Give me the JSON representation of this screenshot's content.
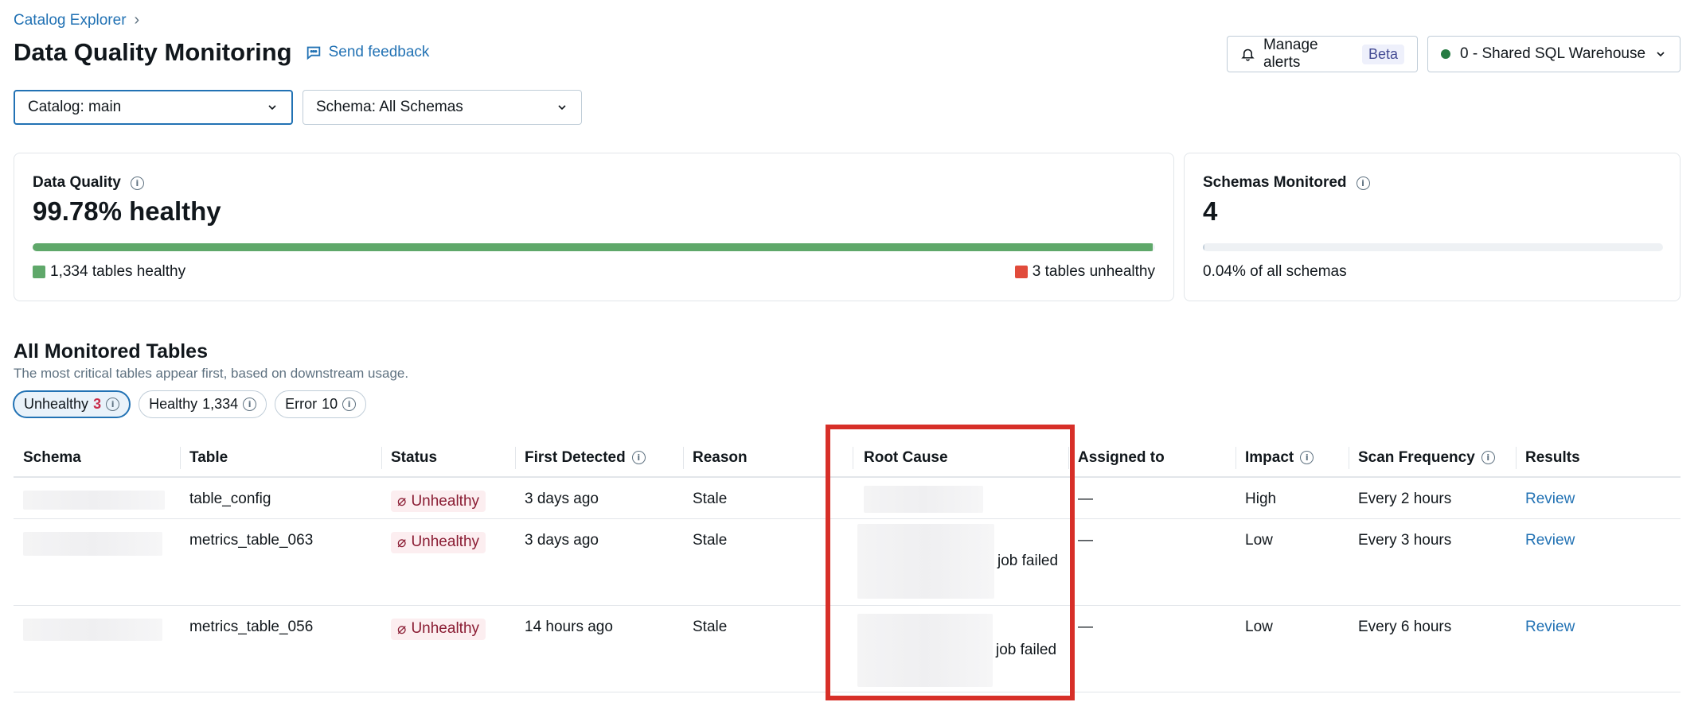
{
  "breadcrumb": {
    "root": "Catalog Explorer",
    "chevron": "›"
  },
  "header": {
    "title": "Data Quality Monitoring",
    "feedback": "Send feedback",
    "manage_alerts": "Manage alerts",
    "beta": "Beta",
    "warehouse": "0 - Shared SQL Warehouse"
  },
  "filters": {
    "catalog": "Catalog: main",
    "schema": "Schema: All Schemas"
  },
  "quality_card": {
    "label": "Data Quality",
    "value": "99.78% healthy",
    "healthy_fraction": 0.9978,
    "healthy_label": "1,334 tables healthy",
    "unhealthy_label": "3 tables unhealthy",
    "healthy_color": "#5fa86a",
    "unhealthy_color": "#e14b3b"
  },
  "schemas_card": {
    "label": "Schemas Monitored",
    "value": "4",
    "fraction": 0.0004,
    "caption": "0.04% of all schemas"
  },
  "section": {
    "title": "All Monitored Tables",
    "subtitle": "The most critical tables appear first, based on downstream usage."
  },
  "pills": [
    {
      "label": "Unhealthy",
      "count": "3"
    },
    {
      "label": "Healthy",
      "count": "1,334"
    },
    {
      "label": "Error",
      "count": "10"
    }
  ],
  "table": {
    "columns": [
      "Schema",
      "Table",
      "Status",
      "First Detected",
      "Reason",
      "Root Cause",
      "Assigned to",
      "Impact",
      "Scan Frequency",
      "Results"
    ],
    "rows": [
      {
        "table": "table_config",
        "status": "Unhealthy",
        "first_detected": "3 days ago",
        "reason": "Stale",
        "root_cause": "",
        "assigned": "—",
        "impact": "High",
        "frequency": "Every 2 hours",
        "results": "Review"
      },
      {
        "table": "metrics_table_063",
        "status": "Unhealthy",
        "first_detected": "3 days ago",
        "reason": "Stale",
        "root_cause": "job failed",
        "assigned": "—",
        "impact": "Low",
        "frequency": "Every 3 hours",
        "results": "Review"
      },
      {
        "table": "metrics_table_056",
        "status": "Unhealthy",
        "first_detected": "14 hours ago",
        "reason": "Stale",
        "root_cause": "job failed",
        "assigned": "—",
        "impact": "Low",
        "frequency": "Every 6 hours",
        "results": "Review"
      }
    ]
  },
  "highlight_color": "#d72f28"
}
